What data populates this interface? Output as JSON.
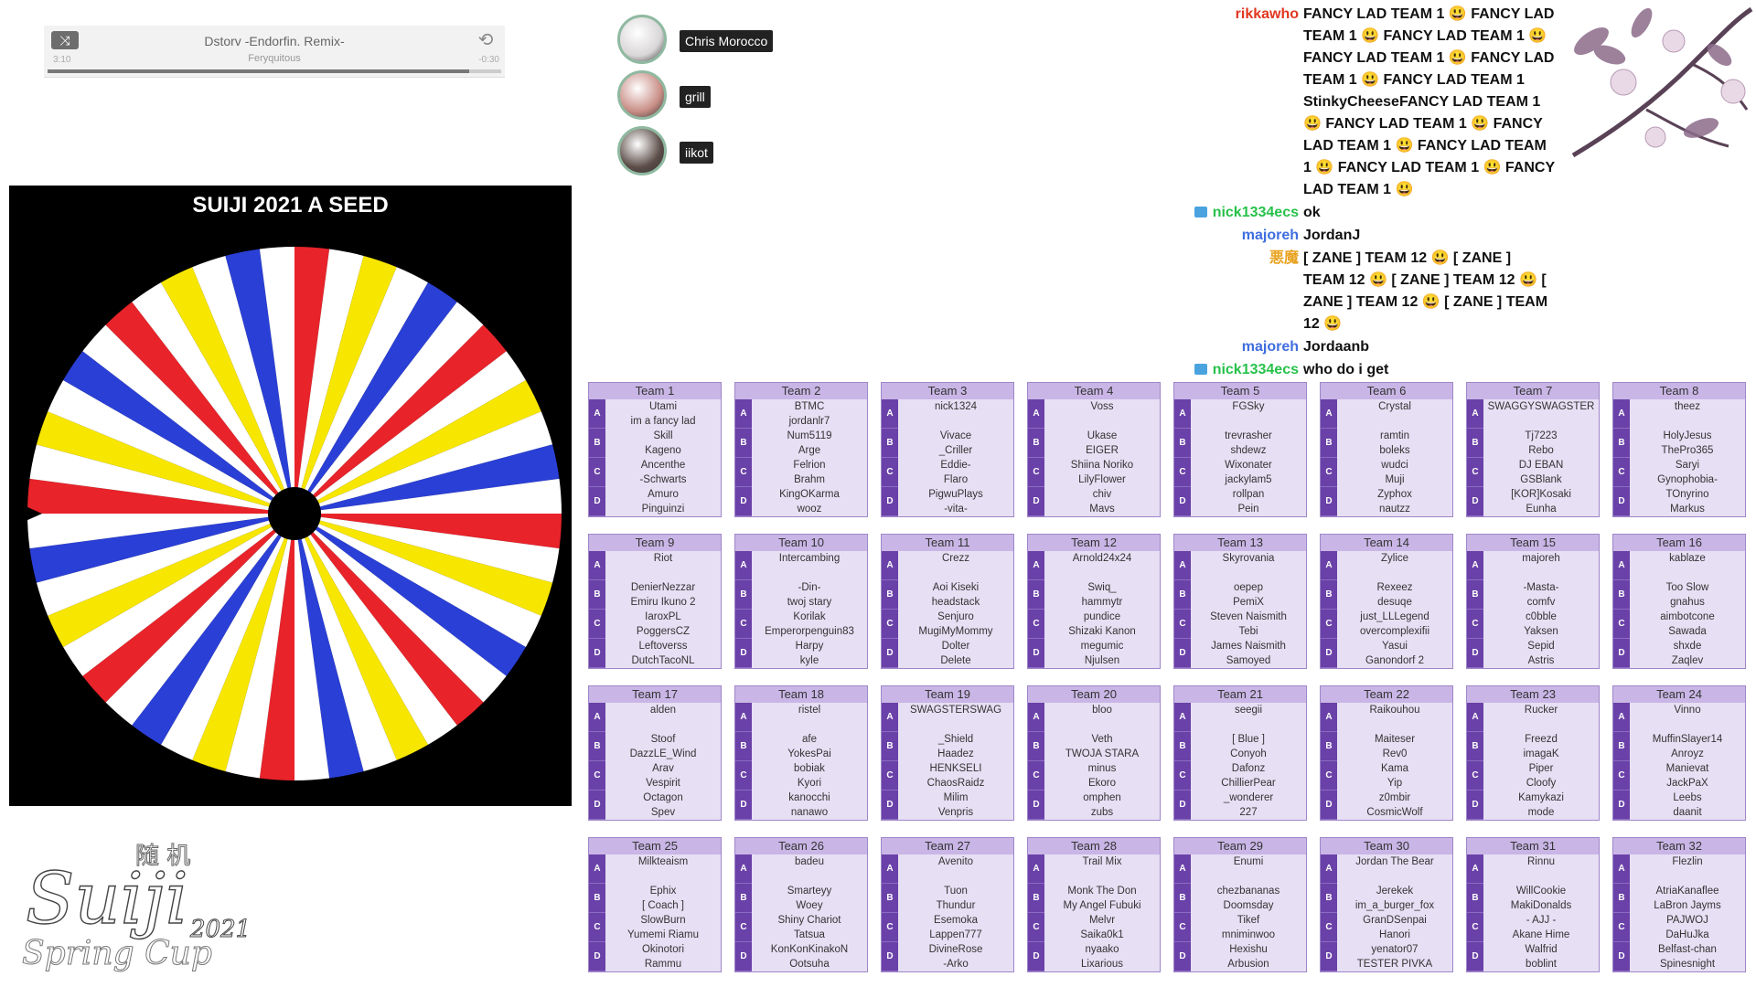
{
  "player": {
    "title": "Dstorv -Endorfin. Remix-",
    "artist": "Feryquitous",
    "elapsed": "3:10",
    "remaining": "-0:30",
    "progress": 0.93
  },
  "viewers": [
    {
      "name": "Chris Morocco",
      "color": "#d9d6d8"
    },
    {
      "name": "grill",
      "color": "#c98e86"
    },
    {
      "name": "iikot",
      "color": "#5c4d48"
    }
  ],
  "wheel": {
    "title": "SUIJI 2021 A SEED",
    "colors": [
      "#e8232a",
      "#ffffff",
      "#f7e600",
      "#ffffff",
      "#2a3fd6",
      "#ffffff"
    ],
    "segments": 48
  },
  "logo": {
    "main": "Suiji",
    "sub": "Spring Cup",
    "year": "2021",
    "kanji": "随 机"
  },
  "chat": [
    {
      "user": "rikkawho",
      "user_color": "#e2371f",
      "badge": false,
      "text": "FANCY LAD TEAM 1 😃 FANCY LAD TEAM 1 😃 FANCY LAD TEAM 1 😃 FANCY LAD TEAM 1 😃 FANCY LAD TEAM 1 😃 FANCY LAD TEAM 1 StinkyCheeseFANCY LAD TEAM 1 😃 FANCY LAD TEAM 1 😃 FANCY LAD TEAM 1 😃 FANCY LAD TEAM 1 😃 FANCY LAD TEAM 1 😃 FANCY LAD TEAM 1 😃"
    },
    {
      "user": "nick1334ecs",
      "user_color": "#27c14a",
      "badge": true,
      "text": "ok"
    },
    {
      "user": "majoreh",
      "user_color": "#3f6ee0",
      "badge": false,
      "text": "JordanJ"
    },
    {
      "user": "悪魔",
      "user_color": "#e8a21e",
      "badge": false,
      "text": "[ ZANE ] TEAM 12 😃 [ ZANE ] TEAM 12 😃 [ ZANE ] TEAM 12 😃 [ ZANE ] TEAM 12 😃 [ ZANE ] TEAM 12 😃"
    },
    {
      "user": "majoreh",
      "user_color": "#3f6ee0",
      "badge": false,
      "text": "Jordaanb"
    },
    {
      "user": "nick1334ecs",
      "user_color": "#27c14a",
      "badge": true,
      "text": "who do i get"
    }
  ],
  "teams": [
    {
      "name": "Team 1",
      "players": [
        "Utami",
        "im a fancy lad",
        "Skill",
        "Kageno",
        "Ancenthe",
        "-Schwarts",
        "Amuro",
        "Pinguinzi"
      ]
    },
    {
      "name": "Team 2",
      "players": [
        "BTMC",
        "jordanlr7",
        "Num5119",
        "Arge",
        "Felrion",
        "Brahm",
        "KingOKarma",
        "wooz"
      ]
    },
    {
      "name": "Team 3",
      "players": [
        "nick1324",
        "",
        "Vivace",
        "_Criller",
        "Eddie-",
        "Flaro",
        "PigwuPlays",
        "-vita-"
      ]
    },
    {
      "name": "Team 4",
      "players": [
        "Voss",
        "",
        "Ukase",
        "EIGER",
        "Shiina Noriko",
        "LilyFlower",
        "chiv",
        "Mavs"
      ]
    },
    {
      "name": "Team 5",
      "players": [
        "FGSky",
        "",
        "trevrasher",
        "shdewz",
        "Wixonater",
        "jackylam5",
        "rollpan",
        "Pein"
      ]
    },
    {
      "name": "Team 6",
      "players": [
        "Crystal",
        "",
        "ramtin",
        "boleks",
        "wudci",
        "Muji",
        "Zyphox",
        "nautzz"
      ]
    },
    {
      "name": "Team 7",
      "players": [
        "SWAGGYSWAGSTER",
        "",
        "Tj7223",
        "Rebo",
        "DJ EBAN",
        "GSBlank",
        "[KOR]Kosaki",
        "Eunha"
      ]
    },
    {
      "name": "Team 8",
      "players": [
        "theez",
        "",
        "HolyJesus",
        "ThePro365",
        "Saryi",
        "Gynophobia-",
        "TOnyrino",
        "Markus"
      ]
    },
    {
      "name": "Team 9",
      "players": [
        "Riot",
        "",
        "DenierNezzar",
        "Emiru Ikuno 2",
        "IaroxPL",
        "PoggersCZ",
        "Leftoverss",
        "DutchTacoNL"
      ]
    },
    {
      "name": "Team 10",
      "players": [
        "Intercambing",
        "",
        "-Din-",
        "twoj stary",
        "Korilak",
        "Emperorpenguin83",
        "Harpy",
        "kyle"
      ]
    },
    {
      "name": "Team 11",
      "players": [
        "Crezz",
        "",
        "Aoi Kiseki",
        "headstack",
        "Senjuro",
        "MugiMyMommy",
        "Dolter",
        "Delete"
      ]
    },
    {
      "name": "Team 12",
      "players": [
        "Arnold24x24",
        "",
        "Swiq_",
        "hammytr",
        "pundice",
        "Shizaki Kanon",
        "megumic",
        "Njulsen"
      ]
    },
    {
      "name": "Team 13",
      "players": [
        "Skyrovania",
        "",
        "oepep",
        "PemiX",
        "Steven Naismith",
        "Tebi",
        "James Naismith",
        "Samoyed"
      ]
    },
    {
      "name": "Team 14",
      "players": [
        "Zylice",
        "",
        "Rexeez",
        "desuqe",
        "just_LLLegend",
        "overcomplexifii",
        "Yasui",
        "Ganondorf 2"
      ]
    },
    {
      "name": "Team 15",
      "players": [
        "majoreh",
        "",
        "-Masta-",
        "comfv",
        "c0bble",
        "Yaksen",
        "Sepid",
        "Astris"
      ]
    },
    {
      "name": "Team 16",
      "players": [
        "kablaze",
        "",
        "Too Slow",
        "gnahus",
        "aimbotcone",
        "Sawada",
        "shxde",
        "Zaqlev"
      ]
    },
    {
      "name": "Team 17",
      "players": [
        "alden",
        "",
        "Stoof",
        "DazzLE_Wind",
        "Arav",
        "Vespirit",
        "Octagon",
        "Spev"
      ]
    },
    {
      "name": "Team 18",
      "players": [
        "ristel",
        "",
        "afe",
        "YokesPai",
        "bobiak",
        "Kyori",
        "kanocchi",
        "nanawo"
      ]
    },
    {
      "name": "Team 19",
      "players": [
        "SWAGSTERSWAG",
        "",
        "_Shield",
        "Haadez",
        "HENKSELI",
        "ChaosRaidz",
        "Milim",
        "Venpris"
      ]
    },
    {
      "name": "Team 20",
      "players": [
        "bloo",
        "",
        "Veth",
        "TWOJA STARA",
        "minus",
        "Ekoro",
        "omphen",
        "zubs"
      ]
    },
    {
      "name": "Team 21",
      "players": [
        "seegii",
        "",
        "[ Blue ]",
        "Conyoh",
        "Dafonz",
        "ChillierPear",
        "_wonderer",
        "227"
      ]
    },
    {
      "name": "Team 22",
      "players": [
        "Raikouhou",
        "",
        "Maiteser",
        "Rev0",
        "Kama",
        "Yip",
        "z0mbir",
        "CosmicWolf"
      ]
    },
    {
      "name": "Team 23",
      "players": [
        "Rucker",
        "",
        "Freezd",
        "imagaK",
        "Piper",
        "Cloofy",
        "Kamykazi",
        "mode"
      ]
    },
    {
      "name": "Team 24",
      "players": [
        "Vinno",
        "",
        "MuffinSlayer14",
        "Anroyz",
        "Manievat",
        "JackPaX",
        "Leebs",
        "daanit"
      ]
    },
    {
      "name": "Team 25",
      "players": [
        "Milkteaism",
        "",
        "Ephix",
        "[ Coach ]",
        "SlowBurn",
        "Yumemi Riamu",
        "Okinotori",
        "Rammu"
      ]
    },
    {
      "name": "Team 26",
      "players": [
        "badeu",
        "",
        "Smarteyy",
        "Woey",
        "Shiny Chariot",
        "Tatsua",
        "KonKonKinakoN",
        "Ootsuha"
      ]
    },
    {
      "name": "Team 27",
      "players": [
        "Avenito",
        "",
        "Tuon",
        "Thundur",
        "Esemoka",
        "Lappen777",
        "DivineRose",
        "-Arko"
      ]
    },
    {
      "name": "Team 28",
      "players": [
        "Trail Mix",
        "",
        "Monk The Don",
        "My Angel Fubuki",
        "Melvr",
        "Saika0k1",
        "nyaako",
        "Lixarious"
      ]
    },
    {
      "name": "Team 29",
      "players": [
        "Enumi",
        "",
        "chezbananas",
        "Doomsday",
        "Tikef",
        "mniminwoo",
        "Hexishu",
        "Arbusion"
      ]
    },
    {
      "name": "Team 30",
      "players": [
        "Jordan The Bear",
        "",
        "Jerekek",
        "im_a_burger_fox",
        "GranDSenpai",
        "Hanori",
        "yenator07",
        "TESTER PIVKA"
      ]
    },
    {
      "name": "Team 31",
      "players": [
        "Rinnu",
        "",
        "WillCookie",
        "MakiDonalds",
        "- AJJ -",
        "Akane Hime",
        "Walfrid",
        "boblint"
      ]
    },
    {
      "name": "Team 32",
      "players": [
        "Flezlin",
        "",
        "AtriaKanaflee",
        "LaBron Jayms",
        "PAJWOJ",
        "DaHuJka",
        "Belfast-chan",
        "Spinesnight"
      ]
    }
  ],
  "seed_labels": [
    "A",
    "B",
    "C",
    "D"
  ]
}
